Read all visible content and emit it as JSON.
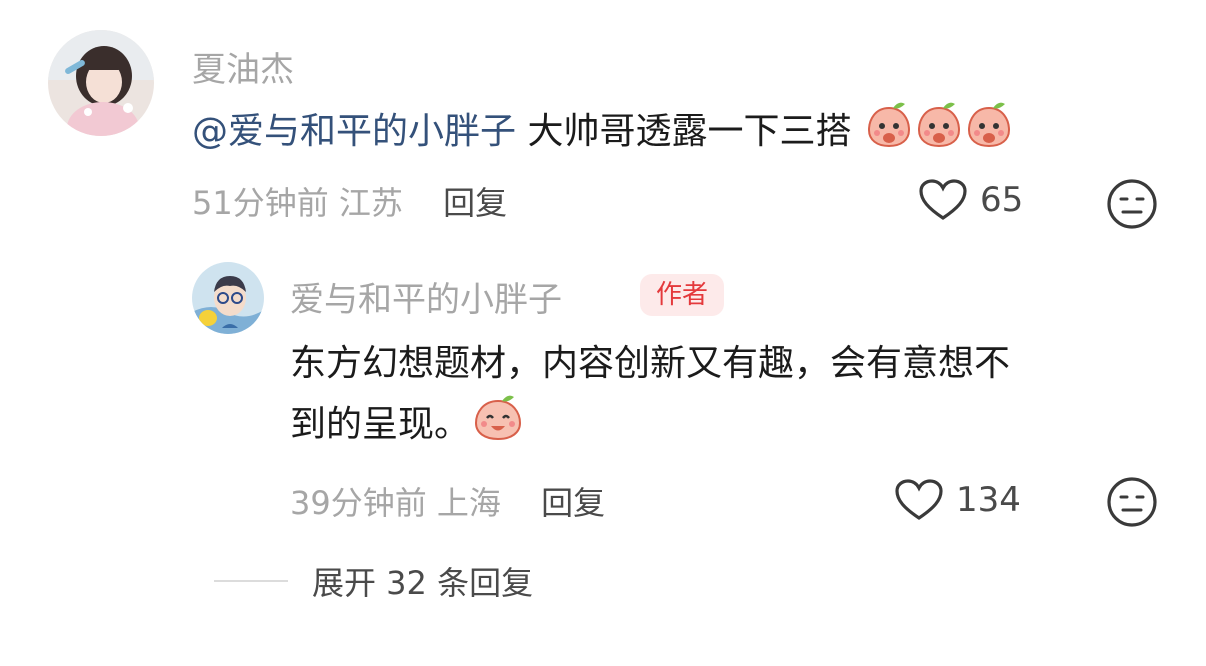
{
  "comment": {
    "username": "夏油杰",
    "mention": "@爱与和平的小胖子",
    "text": " 大帅哥透露一下三搭",
    "emojis": [
      "peach-shy-icon",
      "peach-shy-icon",
      "peach-shy-icon"
    ],
    "time": "51分钟前",
    "location": "江苏",
    "reply_label": "回复",
    "likes": "65"
  },
  "reply": {
    "username": "爱与和平的小胖子",
    "badge": "作者",
    "text_line1": "东方幻想题材，内容创新又有趣，会有意想不",
    "text_line2": "到的呈现。",
    "emoji": "peach-smile-icon",
    "time": "39分钟前",
    "location": "上海",
    "reply_label": "回复",
    "likes": "134"
  },
  "expand": {
    "label": "展开 32 条回复"
  },
  "colors": {
    "mention": "#34517a",
    "secondary_text": "#a6a6a6",
    "badge_bg": "#fdeaea",
    "badge_text": "#e4393c"
  }
}
